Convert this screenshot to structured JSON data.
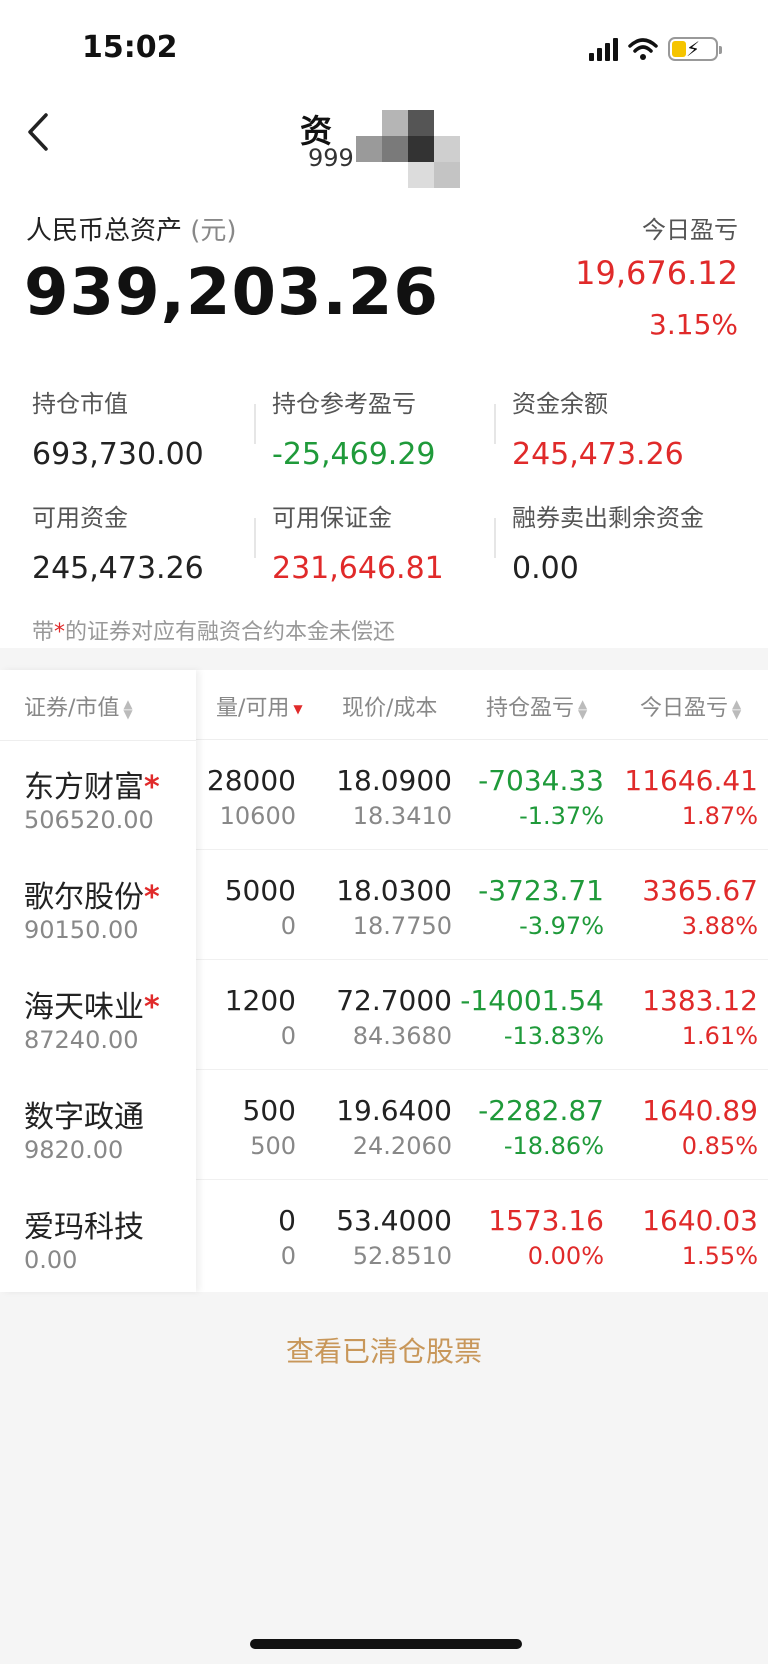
{
  "status_bar": {
    "time": "15:02"
  },
  "nav": {
    "title": "资",
    "subtitle": "999"
  },
  "assets": {
    "total_label": "人民币总资产",
    "total_unit": "(元)",
    "total_value": "939,203.26",
    "today_label": "今日盈亏",
    "today_value": "19,676.12",
    "today_pct": "3.15%"
  },
  "summary": [
    {
      "label": "持仓市值",
      "value": "693,730.00",
      "color": "default"
    },
    {
      "label": "持仓参考盈亏",
      "value": "-25,469.29",
      "color": "green"
    },
    {
      "label": "资金余额",
      "value": "245,473.26",
      "color": "red"
    },
    {
      "label": "可用资金",
      "value": "245,473.26",
      "color": "default"
    },
    {
      "label": "可用保证金",
      "value": "231,646.81",
      "color": "red"
    },
    {
      "label": "融券卖出剩余资金",
      "value": "0.00",
      "color": "default"
    }
  ],
  "note": {
    "prefix": "带",
    "star": "*",
    "text": "的证券对应有融资合约本金未偿还"
  },
  "table": {
    "headers": {
      "security": "证券/市值",
      "qty": "量/可用",
      "price": "现价/成本",
      "position_pl": "持仓盈亏",
      "today_pl": "今日盈亏"
    },
    "rows": [
      {
        "name": "东方财富",
        "star": "*",
        "market_value": "506520.00",
        "qty": "28000",
        "available": "10600",
        "price": "18.0900",
        "cost": "18.3410",
        "pos_pl": "-7034.33",
        "pos_pct": "-1.37%",
        "pos_color": "green",
        "today_pl": "11646.41",
        "today_pct": "1.87%",
        "today_color": "red"
      },
      {
        "name": "歌尔股份",
        "star": "*",
        "market_value": "90150.00",
        "qty": "5000",
        "available": "0",
        "price": "18.0300",
        "cost": "18.7750",
        "pos_pl": "-3723.71",
        "pos_pct": "-3.97%",
        "pos_color": "green",
        "today_pl": "3365.67",
        "today_pct": "3.88%",
        "today_color": "red"
      },
      {
        "name": "海天味业",
        "star": "*",
        "market_value": "87240.00",
        "qty": "1200",
        "available": "0",
        "price": "72.7000",
        "cost": "84.3680",
        "pos_pl": "-14001.54",
        "pos_pct": "-13.83%",
        "pos_color": "green",
        "today_pl": "1383.12",
        "today_pct": "1.61%",
        "today_color": "red"
      },
      {
        "name": "数字政通",
        "star": "",
        "market_value": "9820.00",
        "qty": "500",
        "available": "500",
        "price": "19.6400",
        "cost": "24.2060",
        "pos_pl": "-2282.87",
        "pos_pct": "-18.86%",
        "pos_color": "green",
        "today_pl": "1640.89",
        "today_pct": "0.85%",
        "today_color": "red"
      },
      {
        "name": "爱玛科技",
        "star": "",
        "market_value": "0.00",
        "qty": "0",
        "available": "0",
        "price": "53.4000",
        "cost": "52.8510",
        "pos_pl": "1573.16",
        "pos_pct": "0.00%",
        "pos_color": "red",
        "today_pl": "1640.03",
        "today_pct": "1.55%",
        "today_color": "red"
      }
    ]
  },
  "cleared_link": "查看已清仓股票",
  "icons": [
    "back-chevron-icon",
    "signal-icon",
    "wifi-icon",
    "battery-charging-icon",
    "sort-icon"
  ],
  "colors": {
    "red": "#e02a2a",
    "green": "#1f9a3a",
    "link": "#c8975a"
  }
}
